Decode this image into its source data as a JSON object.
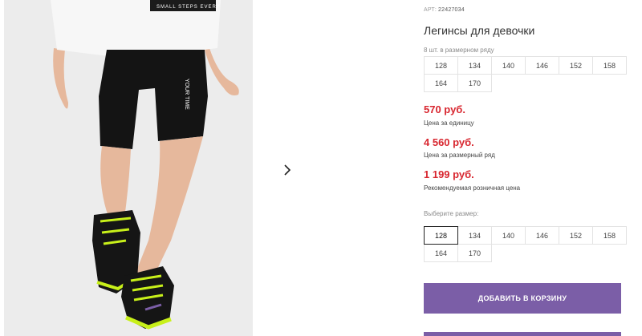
{
  "product": {
    "sku_label": "АРТ:",
    "sku_value": "22427034",
    "title": "Легинсы для девочки",
    "row_note": "8 шт. в размерном ряду",
    "row_sizes": [
      "128",
      "134",
      "140",
      "146",
      "152",
      "158",
      "164",
      "170"
    ],
    "unit_price": "570 руб.",
    "unit_price_caption": "Цена за единицу",
    "row_price": "4 560 руб.",
    "row_price_caption": "Цена за размерный ряд",
    "retail_price": "1 199 руб.",
    "retail_price_caption": "Рекомендуемая розничная цена",
    "choose_size_label": "Выберите размер:",
    "select_sizes": [
      "128",
      "134",
      "140",
      "146",
      "152",
      "158",
      "164",
      "170"
    ],
    "selected_size": "128",
    "add_to_cart_label": "ДОБАВИТЬ В КОРЗИНУ"
  },
  "gallery": {
    "next_icon": "chevron-right-icon",
    "shirt_print": "SMALL STEPS EVERY",
    "leggings_print": "YOUR TIME"
  },
  "colors": {
    "price": "#d8262f",
    "button": "#7b5ea7",
    "shoe_accent": "#c8f01a"
  }
}
